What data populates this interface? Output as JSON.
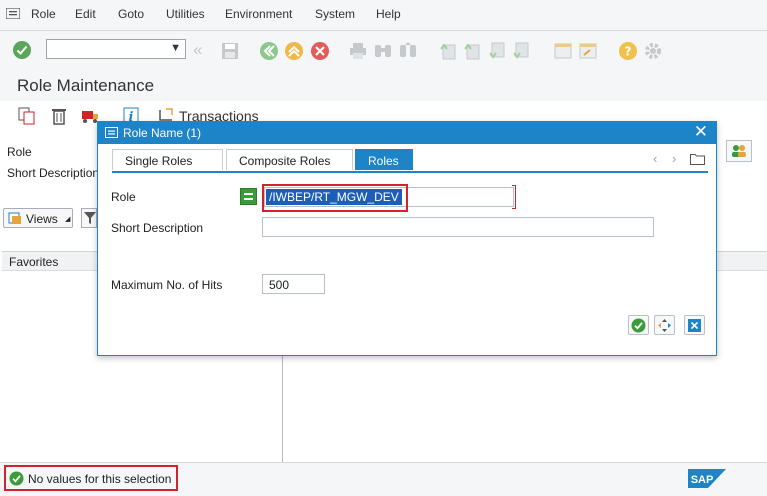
{
  "menu": {
    "items": [
      "Role",
      "Edit",
      "Goto",
      "Utilities",
      "Environment",
      "System",
      "Help"
    ]
  },
  "page": {
    "title": "Role Maintenance"
  },
  "app_toolbar": {
    "transactions_label": "Transactions"
  },
  "form": {
    "role_label": "Role",
    "short_description_label": "Short Description",
    "views_label": "Views"
  },
  "favorites": {
    "label": "Favorites"
  },
  "dialog": {
    "title": "Role Name (1)",
    "tabs": [
      "Single Roles",
      "Composite Roles",
      "Roles"
    ],
    "active_tab": "Roles",
    "role_label": "Role",
    "role_value": "/IWBEP/RT_MGW_DEV",
    "short_description_label": "Short Description",
    "short_description_value": "",
    "max_hits_label": "Maximum No. of Hits",
    "max_hits_value": "500"
  },
  "status": {
    "message": "No values for this selection",
    "type": "success"
  },
  "colors": {
    "sap_blue": "#1d84c7",
    "highlight_red": "#d0232a",
    "success_green": "#3a9b3a",
    "orange": "#e8a33d",
    "toolbar_green": "#5aa65a",
    "delete_red": "#e35b5b"
  },
  "icons": {
    "menu": "sap-menu-icon",
    "ok": "check-icon",
    "back": "back-icon",
    "save": "save-icon",
    "exit": "exit-icon",
    "logo": "sap-logo"
  }
}
